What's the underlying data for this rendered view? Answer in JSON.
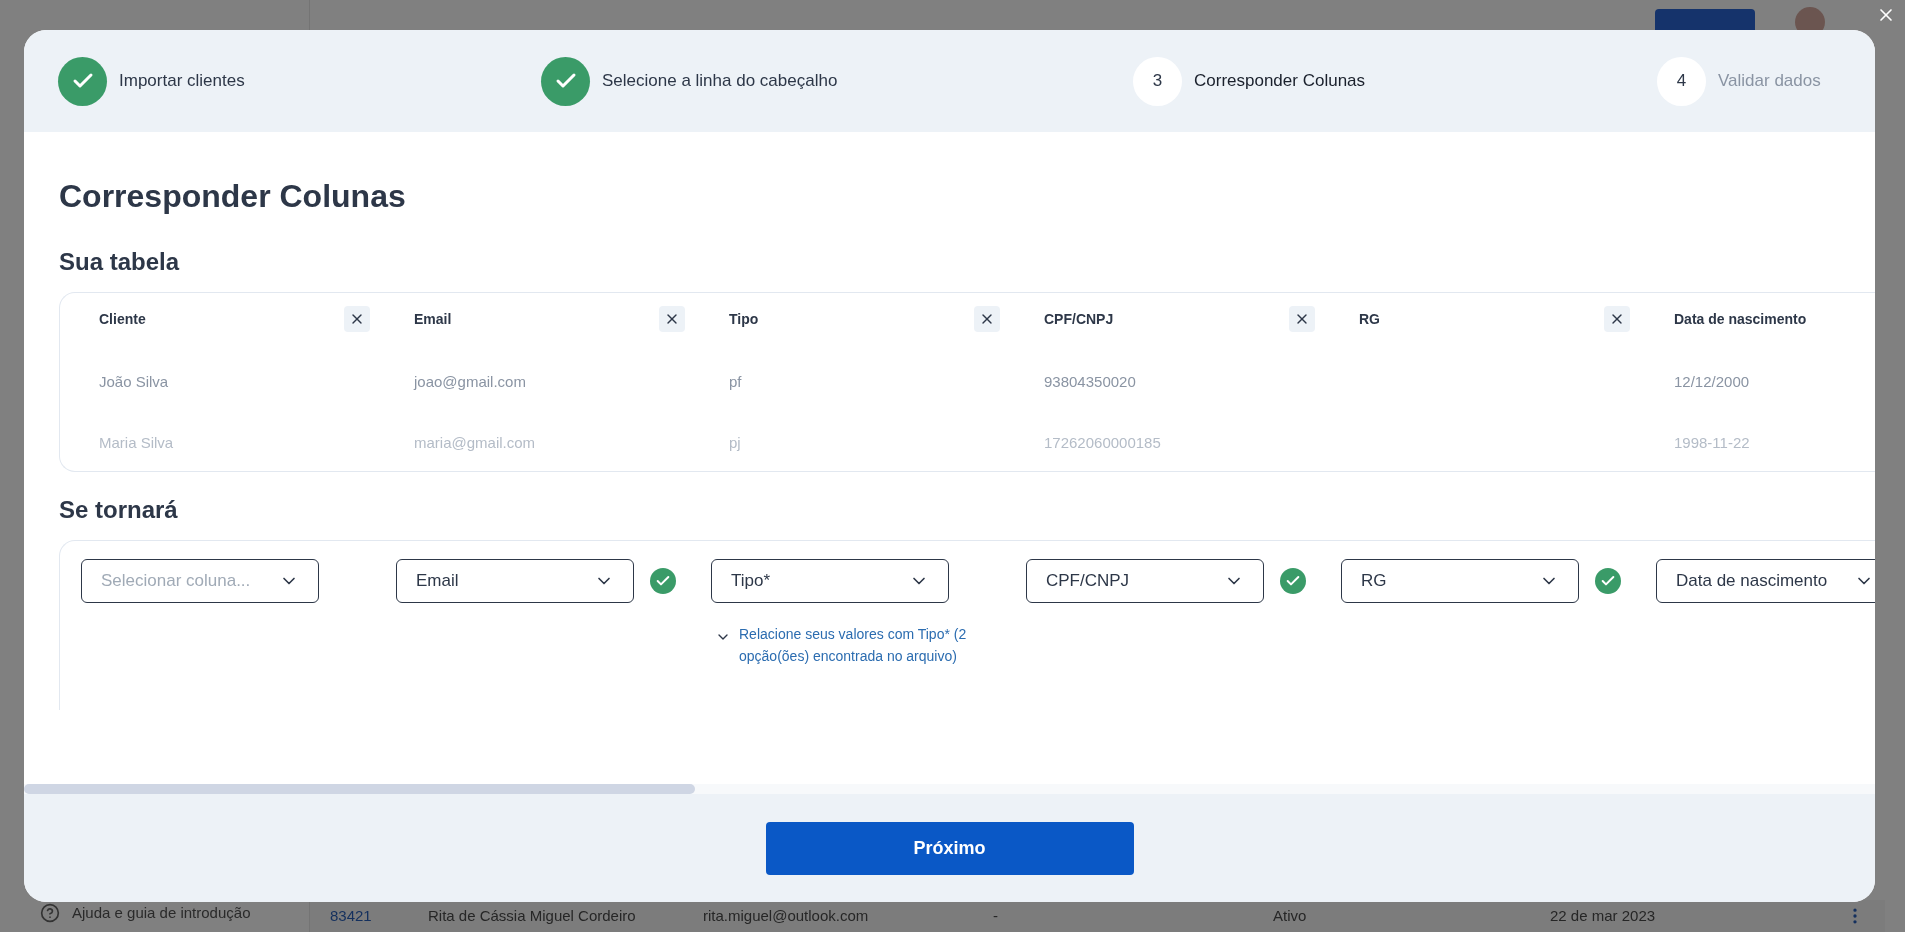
{
  "steps": [
    {
      "label": "Importar clientes",
      "completed": true,
      "selected": false
    },
    {
      "label": "Selecione a linha do cabeçalho",
      "completed": true,
      "selected": false
    },
    {
      "number": "3",
      "label": "Corresponder Colunas",
      "completed": false,
      "selected": true
    },
    {
      "number": "4",
      "label": "Validar dados",
      "completed": false,
      "selected": false
    }
  ],
  "title": "Corresponder Colunas",
  "source_section": "Sua tabela",
  "target_section": "Se tornará",
  "columns": [
    {
      "header": "Cliente",
      "rows": [
        "João Silva",
        "Maria Silva"
      ],
      "select": {
        "placeholder": "Selecionar coluna..."
      },
      "matched": false
    },
    {
      "header": "Email",
      "rows": [
        "joao@gmail.com",
        "maria@gmail.com"
      ],
      "select": {
        "value": "Email"
      },
      "matched": true
    },
    {
      "header": "Tipo",
      "rows": [
        "pf",
        "pj"
      ],
      "select": {
        "value": "Tipo*"
      },
      "matched": false,
      "hint": "Relacione seus valores com Tipo* (2 opção(ões) encontrada no arquivo)"
    },
    {
      "header": "CPF/CNPJ",
      "rows": [
        "93804350020",
        "17262060000185"
      ],
      "select": {
        "value": "CPF/CNPJ"
      },
      "matched": true
    },
    {
      "header": "RG",
      "rows": [
        "",
        ""
      ],
      "select": {
        "value": "RG"
      },
      "matched": true
    },
    {
      "header": "Data de nascimento",
      "rows": [
        "12/12/2000",
        "1998-11-22"
      ],
      "select": {
        "value": "Data de nascimento"
      }
    }
  ],
  "next_button": "Próximo",
  "background": {
    "help_link": "Ajuda e guia de introdução",
    "row": [
      "83421",
      "Rita de Cássia Miguel Cordeiro",
      "rita.miguel@outlook.com",
      "-",
      "Ativo",
      "22 de mar 2023"
    ]
  }
}
